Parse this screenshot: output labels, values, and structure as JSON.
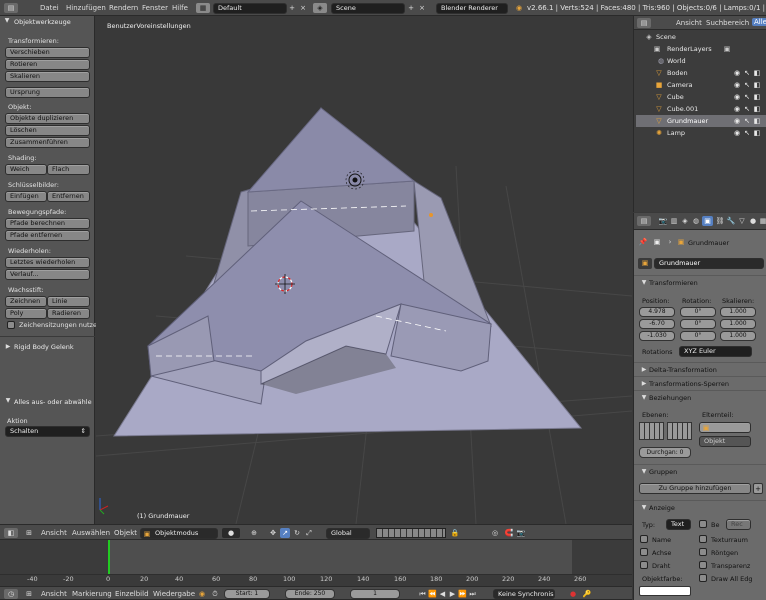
{
  "topbar": {
    "menus": [
      "Datei",
      "Hinzufügen",
      "Rendern",
      "Fenster",
      "Hilfe"
    ],
    "layout": "Default",
    "scene": "Scene",
    "renderer": "Blender Renderer",
    "stats": "v2.66.1 | Verts:524 | Faces:480 | Tris:960 | Objects:0/6 | Lamps:0/1 | Mem:19"
  },
  "toolshelf": {
    "title": "Objektwerkzeuge",
    "sections": {
      "transform": "Transformieren:",
      "object": "Objekt:",
      "shading": "Shading:",
      "keyframes": "Schlüsselbilder:",
      "motion": "Bewegungspfade:",
      "history": "Wiederholen:",
      "grease": "Wachsstift:"
    },
    "buttons": {
      "move": "Verschieben",
      "rotate": "Rotieren",
      "scale": "Skalieren",
      "origin": "Ursprung",
      "duplicate": "Objekte duplizieren",
      "delete": "Löschen",
      "join": "Zusammenführen",
      "smooth": "Weich",
      "flat": "Flach",
      "insert": "Einfügen",
      "remove": "Entfernen",
      "calc_paths": "Pfade berechnen",
      "clear_paths": "Pfade entfernen",
      "repeat_last": "Letztes wiederholen",
      "history": "Verlauf...",
      "draw": "Zeichnen",
      "line": "Linie",
      "poly": "Poly",
      "erase": "Radieren"
    },
    "sketch": "Zeichensitzungen nutze",
    "rigid": "Rigid Body Gelenk",
    "operator": "Alles aus- oder abwähle",
    "action_label": "Aktion",
    "action_value": "Schalten"
  },
  "viewport": {
    "view_label": "BenutzerVoreinstellungen",
    "object_label": "(1) Grundmauer"
  },
  "outliner": {
    "view": "Ansicht",
    "search": "Suchbereich",
    "all": "Alle",
    "items": [
      {
        "name": "Scene"
      },
      {
        "name": "RenderLayers"
      },
      {
        "name": "World"
      },
      {
        "name": "Boden"
      },
      {
        "name": "Camera"
      },
      {
        "name": "Cube"
      },
      {
        "name": "Cube.001"
      },
      {
        "name": "Grundmauer"
      },
      {
        "name": "Lamp"
      }
    ]
  },
  "properties": {
    "object_name": "Grundmauer",
    "name_field": "Grundmauer",
    "transform": "Transformieren",
    "position": "Position:",
    "rotation": "Rotation:",
    "scale": "Skalieren:",
    "pos": [
      "4.978",
      "-6.70",
      "-1.030"
    ],
    "rot": [
      "0°",
      "0°",
      "0°"
    ],
    "scl": [
      "1.000",
      "1.000",
      "1.000"
    ],
    "rot_mode_label": "Rotations",
    "rot_mode": "XYZ Euler",
    "delta": "Delta-Transformation",
    "locks": "Transformations-Sperren",
    "relations": "Beziehungen",
    "layers": "Ebenen:",
    "parent": "Elternteil:",
    "parent_type": "Objekt",
    "pass_index": "Durchgan: 0",
    "groups": "Gruppen",
    "add_group": "Zu Gruppe hinzufügen",
    "display": "Anzeige",
    "type_label": "Typ:",
    "type_value": "Text",
    "bounds": "Be",
    "bounds_type": "Rec",
    "name": "Name",
    "texture_space": "Texturraum",
    "axis": "Achse",
    "xray": "Röntgen",
    "wire": "Draht",
    "transparency": "Transparenz",
    "draw_all_edges": "Draw All Edg",
    "object_color": "Objektfarbe:"
  },
  "view3d_header": {
    "view": "Ansicht",
    "select": "Auswählen",
    "object": "Objekt",
    "mode": "Objektmodus",
    "orientation": "Global"
  },
  "timeline": {
    "ticks": [
      "-40",
      "-20",
      "0",
      "20",
      "40",
      "60",
      "80",
      "100",
      "120",
      "140",
      "160",
      "180",
      "200",
      "220",
      "240",
      "260"
    ],
    "footer": {
      "view": "Ansicht",
      "marker": "Markierung",
      "frame": "Einzelbild",
      "playback": "Wiedergabe",
      "start": "Start: 1",
      "end": "Ende: 250",
      "current": "1",
      "sync": "Keine Synchronisa"
    }
  },
  "colors": {
    "accent": "#5680c2",
    "mesh": "#8a8aa8",
    "ground": "#a8a8c4",
    "frame_line": "#22cc22"
  }
}
